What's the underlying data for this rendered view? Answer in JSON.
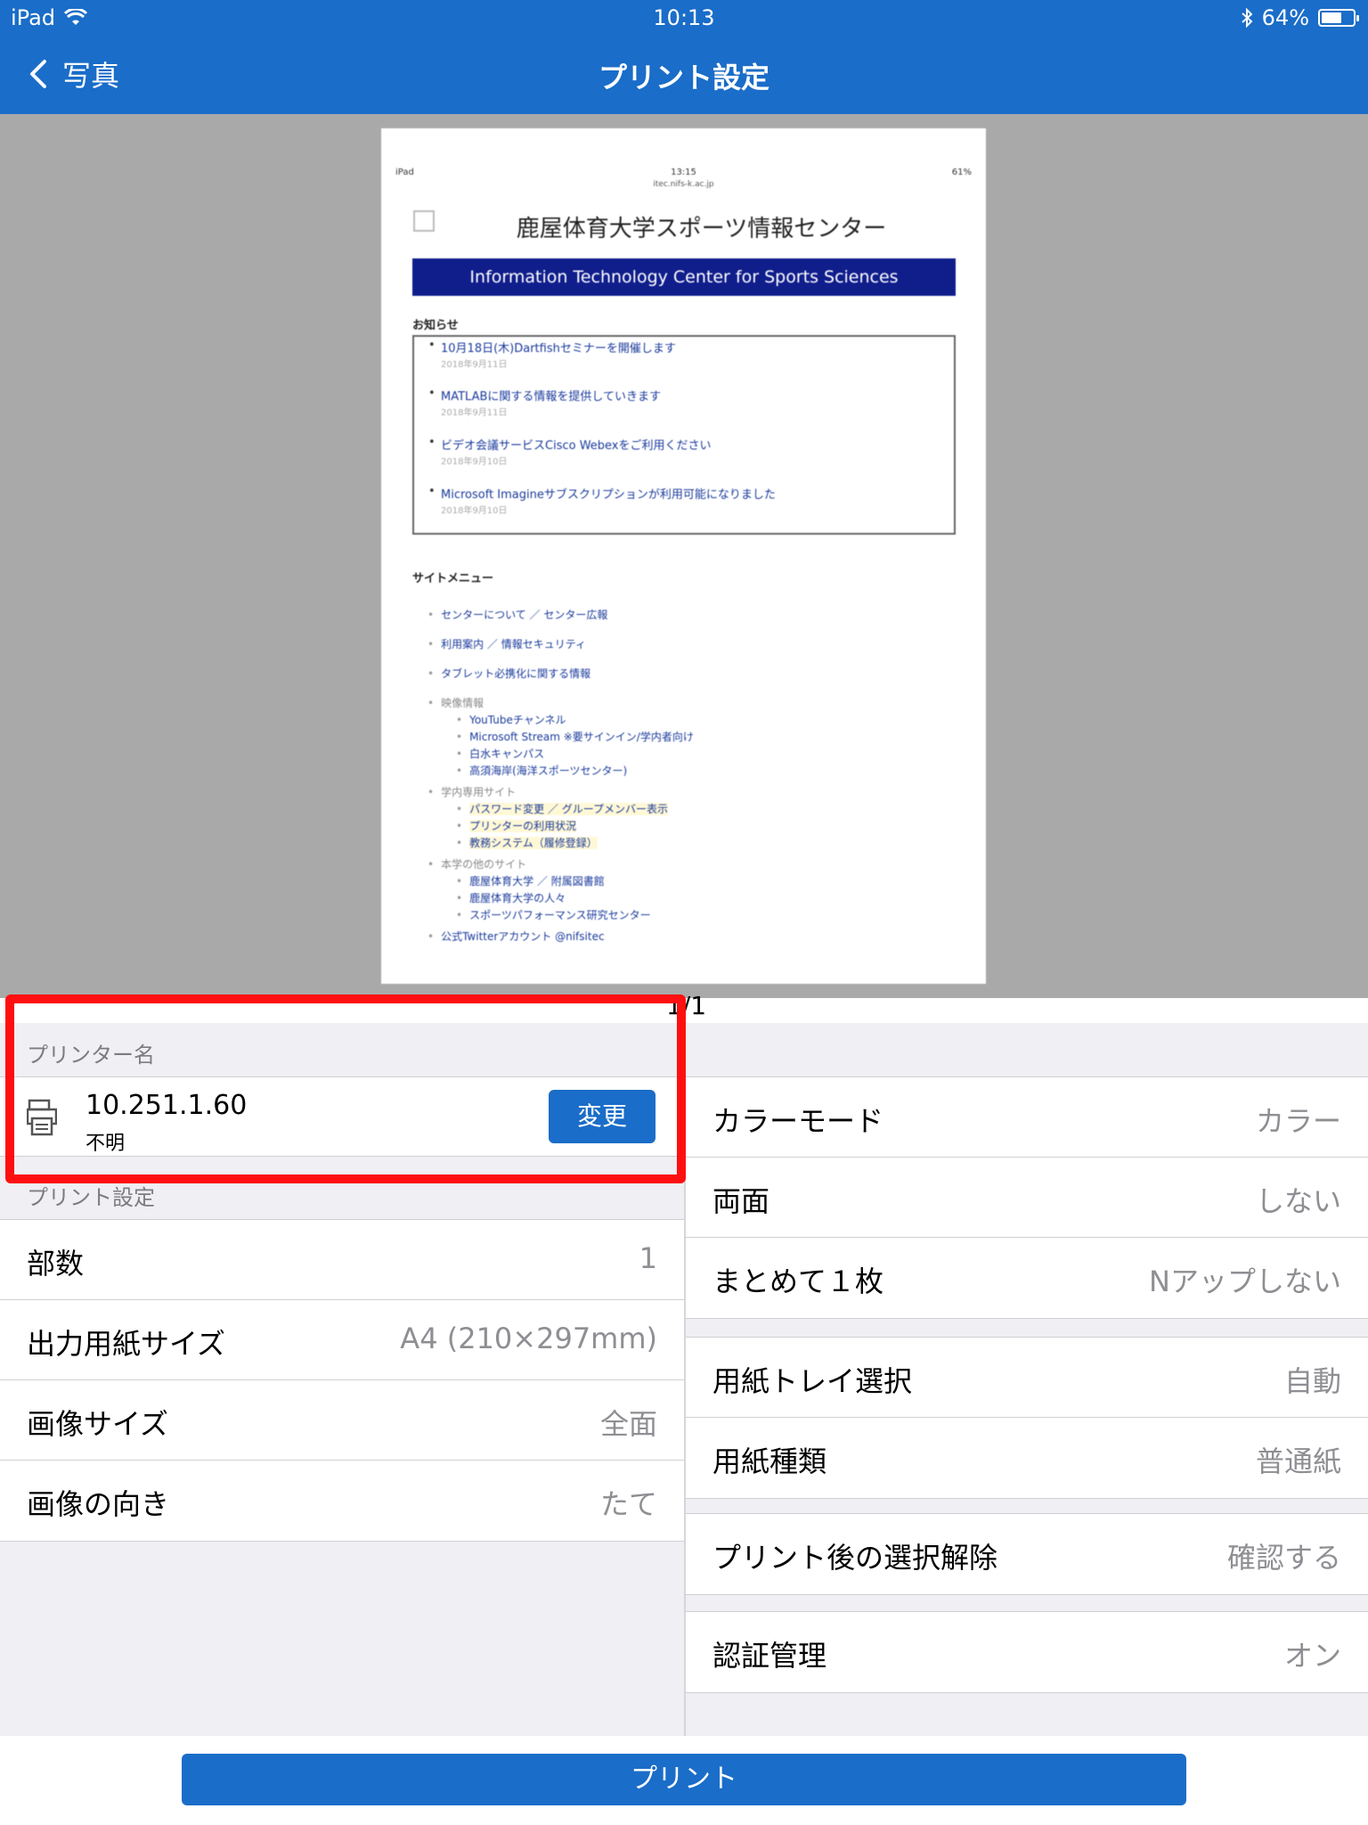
{
  "status_bar": {
    "device": "iPad",
    "time": "10:13",
    "battery": "64%",
    "battery_fraction": 0.64
  },
  "nav": {
    "back_label": "写真",
    "title": "プリント設定"
  },
  "preview": {
    "page_indicator": "1/1",
    "doc": {
      "status_left": "iPad",
      "status_time": "13:15",
      "status_right": "61%",
      "url": "itec.nifs-k.ac.jp",
      "title": "鹿屋体育大学スポーツ情報センター",
      "banner": "Information Technology Center for Sports Sciences",
      "news_heading": "お知らせ",
      "news": [
        {
          "text": "10月18日(木)Dartfishセミナーを開催します",
          "date": "2018年9月11日"
        },
        {
          "text": "MATLABに関する情報を提供していきます",
          "date": "2018年9月11日"
        },
        {
          "text": "ビデオ会議サービスCisco Webexをご利用ください",
          "date": "2018年9月10日"
        },
        {
          "text": "Microsoft Imagineサブスクリプションが利用可能になりました",
          "date": "2018年9月10日"
        }
      ],
      "menu_heading": "サイトメニュー",
      "menu": [
        "センターについて ／ センター広報",
        "利用案内 ／ 情報セキュリティ",
        "タブレット必携化に関する情報",
        "映像情報",
        "YouTubeチャンネル",
        "Microsoft Stream ※要サインイン/学内者向け",
        "白水キャンパス",
        "高須海岸(海洋スポーツセンター)",
        "学内専用サイト",
        "パスワード変更 ／ グループメンバー表示",
        "プリンターの利用状況",
        "教務システム（履修登録）",
        "本学の他のサイト",
        "鹿屋体育大学 ／ 附属図書館",
        "鹿屋体育大学の人々",
        "スポーツパフォーマンス研究センター",
        "公式Twitterアカウント @nifsitec"
      ]
    }
  },
  "printer": {
    "section_label": "プリンター名",
    "ip": "10.251.1.60",
    "status": "不明",
    "change_label": "変更",
    "icon": "printer-icon"
  },
  "left_settings": {
    "section_label": "プリント設定",
    "rows": [
      {
        "label": "部数",
        "value": "1"
      },
      {
        "label": "出力用紙サイズ",
        "value": "A4 (210×297mm)"
      },
      {
        "label": "画像サイズ",
        "value": "全面"
      },
      {
        "label": "画像の向き",
        "value": "たて"
      }
    ]
  },
  "right_settings": {
    "group1": [
      {
        "label": "カラーモード",
        "value": "カラー"
      },
      {
        "label": "両面",
        "value": "しない"
      },
      {
        "label": "まとめて１枚",
        "value": "Nアップしない"
      }
    ],
    "group2": [
      {
        "label": "用紙トレイ選択",
        "value": "自動"
      },
      {
        "label": "用紙種類",
        "value": "普通紙"
      }
    ],
    "group3": [
      {
        "label": "プリント後の選択解除",
        "value": "確認する"
      }
    ],
    "group4": [
      {
        "label": "認証管理",
        "value": "オン"
      }
    ]
  },
  "print_button": "プリント",
  "colors": {
    "accent": "#1a6dc8",
    "highlight": "#ff0f0f"
  }
}
